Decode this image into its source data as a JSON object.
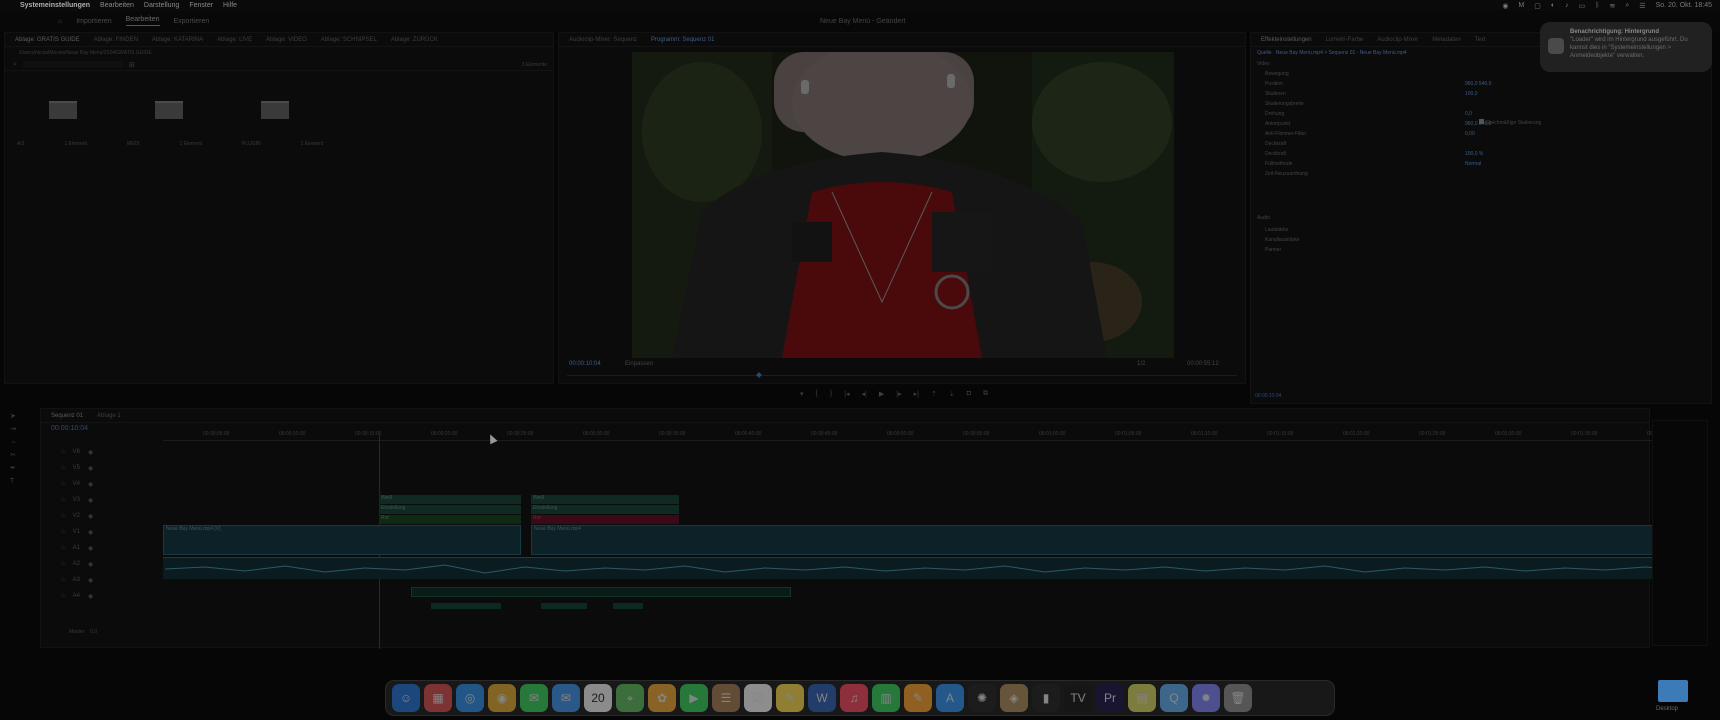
{
  "menubar": {
    "apple": "",
    "app_name": "Systemeinstellungen",
    "items": [
      "Bearbeiten",
      "Darstellung",
      "Fenster",
      "Hilfe"
    ],
    "clock": "So. 20. Okt.  18:45"
  },
  "pr_header": {
    "tabs": [
      "Importieren",
      "Bearbeiten",
      "Exportieren"
    ],
    "active_tab": "Bearbeiten",
    "project_title": "Neue Bay Menü - Geändert"
  },
  "project_panel": {
    "tabs": [
      "Ablage: GRATIS GUIDE",
      "Ablage: FINDEN",
      "Ablage: KATARINA",
      "Ablage: LIVE",
      "Ablage: VIDEO",
      "Ablage: SCHNIPSEL",
      "Ablage: ZURÜCK"
    ],
    "path": "/Users/nicola/Movies/Neue Bay Menü/2024/GRATIS GUIDE",
    "item_count": "3 Elemente",
    "bins": [
      {
        "label": "A/1",
        "meta": "1 Element"
      },
      {
        "label": "MEDI",
        "meta": "1 Element"
      },
      {
        "label": "PLUGIN",
        "meta": "1 Element"
      }
    ]
  },
  "source_panel": {
    "tabs": [
      "Audioclip-Mixer: Sequenz",
      "Programm: Sequenz 01"
    ],
    "active_tab": "Programm: Sequenz 01",
    "timecode_in": "00:00:10:04",
    "fit": "Einpassen",
    "ratio": "1/2",
    "timecode_out": "00:00:55:12"
  },
  "effects_panel": {
    "tabs": [
      "Effekteinstellungen",
      "Lumetri-Farbe",
      "Audioclip-Mixer",
      "Metadaten",
      "Text"
    ],
    "source_line": "Quelle · Neue Bay Menü.mp4  >  Sequenz 01 · Neue Bay Menü.mp4",
    "section_video": "Video",
    "rows": [
      {
        "label": "Bewegung",
        "value": ""
      },
      {
        "label": "Position",
        "value": "960,0   540,0"
      },
      {
        "label": "Skalieren",
        "value": "100,0"
      },
      {
        "label": "Skalierungsbreite",
        "value": ""
      },
      {
        "label": "Drehung",
        "value": "0,0"
      },
      {
        "label": "Ankerpunkt",
        "value": "960,0   540,0"
      },
      {
        "label": "Anti-Flimmer-Filter",
        "value": "0,00"
      },
      {
        "label": "Deckkraft",
        "value": ""
      },
      {
        "label": "Deckkraft",
        "value": "100,0 %"
      },
      {
        "label": "Füllmethode",
        "value": "Normal"
      },
      {
        "label": "Zeit-Neuzuordnung",
        "value": ""
      }
    ],
    "checkbox_label": "Gleichmäßige Skalierung",
    "section_audio": "Audio",
    "audio_rows": [
      "Lautstärke",
      "Kanallautstärke",
      "Panner"
    ],
    "timecode": "00:00:10:04"
  },
  "timeline": {
    "tabs": [
      "Sequenz 01",
      "Ablage 1"
    ],
    "timecode": "00:00:10:04",
    "ruler": [
      "00:00:05:00",
      "00:00:10:00",
      "00:00:15:00",
      "00:00:20:00",
      "00:00:25:00",
      "00:00:30:00",
      "00:00:35:00",
      "00:00:40:00",
      "00:00:45:00",
      "00:00:50:00",
      "00:00:55:00",
      "00:01:00:00",
      "00:01:05:00",
      "00:01:10:00",
      "00:01:15:00",
      "00:01:20:00",
      "00:01:25:00",
      "00:01:30:00",
      "00:01:35:00",
      "00:01:40:00"
    ],
    "tracks": [
      {
        "id": "V6",
        "label": "V6"
      },
      {
        "id": "V5",
        "label": "V5"
      },
      {
        "id": "V4",
        "label": "V4"
      },
      {
        "id": "V3",
        "label": "V3"
      },
      {
        "id": "V2",
        "label": "V2"
      },
      {
        "id": "V1",
        "label": "V1"
      },
      {
        "id": "A1",
        "label": "A1"
      },
      {
        "id": "A2",
        "label": "A2"
      },
      {
        "id": "A3",
        "label": "A3"
      },
      {
        "id": "A4",
        "label": "A4"
      }
    ],
    "clips": [
      {
        "label": "Weiß"
      },
      {
        "label": "Einstellung"
      },
      {
        "label": "Rot"
      },
      {
        "label": "Weiß"
      },
      {
        "label": "Einstellung"
      },
      {
        "label": "Rot"
      },
      {
        "label": "Neue Bay Menü.mp4 [V]"
      },
      {
        "label": "Neue Bay Menü.mp4"
      }
    ],
    "master": "Master",
    "master_value": "0,0"
  },
  "notification": {
    "title": "Benachrichtigung: Hintergrund",
    "body": "\"Loader\" wird im Hintergrund ausgeführt. Du kannst dies in \"Systemeinstellungen > Anmeldeobjekte\" verwalten."
  },
  "dock": {
    "calendar_day": "20",
    "desktop_label": "Desktop",
    "apps": [
      {
        "name": "finder-icon",
        "glyph": "☺",
        "color": "#1f6fd1"
      },
      {
        "name": "launchpad-icon",
        "glyph": "▦",
        "color": "#d04a4a"
      },
      {
        "name": "safari-icon",
        "glyph": "◎",
        "color": "#2a8ae0"
      },
      {
        "name": "chrome-icon",
        "glyph": "◉",
        "color": "#d9a52e"
      },
      {
        "name": "messages-icon",
        "glyph": "✉",
        "color": "#34c759"
      },
      {
        "name": "mail-icon",
        "glyph": "✉",
        "color": "#3a8ee6"
      },
      {
        "name": "calendar-icon",
        "glyph": "20",
        "color": "#e9e9e9"
      },
      {
        "name": "maps-icon",
        "glyph": "⌖",
        "color": "#5bb55b"
      },
      {
        "name": "photos-icon",
        "glyph": "✿",
        "color": "#e6a030"
      },
      {
        "name": "facetime-icon",
        "glyph": "▶",
        "color": "#34c759"
      },
      {
        "name": "contacts-icon",
        "glyph": "☰",
        "color": "#a07850"
      },
      {
        "name": "reminders-icon",
        "glyph": "☑",
        "color": "#eeeeee"
      },
      {
        "name": "notes-icon",
        "glyph": "✎",
        "color": "#f3d34a"
      },
      {
        "name": "word-icon",
        "glyph": "W",
        "color": "#2b5cad"
      },
      {
        "name": "music-icon",
        "glyph": "♫",
        "color": "#f0445a"
      },
      {
        "name": "numbers-icon",
        "glyph": "▥",
        "color": "#34c759"
      },
      {
        "name": "pages-icon",
        "glyph": "✎",
        "color": "#f29b2b"
      },
      {
        "name": "appstore-icon",
        "glyph": "A",
        "color": "#2f8de8"
      },
      {
        "name": "chatgpt-icon",
        "glyph": "✺",
        "color": "#202020"
      },
      {
        "name": "preview-icon",
        "glyph": "◈",
        "color": "#a88858"
      },
      {
        "name": "audio-icon",
        "glyph": "▮",
        "color": "#202020"
      },
      {
        "name": "tradingview-icon",
        "glyph": "TV",
        "color": "#151515"
      },
      {
        "name": "premiere-icon",
        "glyph": "Pr",
        "color": "#1a1446"
      },
      {
        "name": "archive-icon",
        "glyph": "▤",
        "color": "#cfcf60"
      },
      {
        "name": "quicktime-icon",
        "glyph": "Q",
        "color": "#5aa8e8"
      },
      {
        "name": "settings-icon",
        "glyph": "✹",
        "color": "#7a7cf0"
      },
      {
        "name": "trash-icon",
        "glyph": "🗑",
        "color": "#8a8a8a"
      }
    ]
  }
}
